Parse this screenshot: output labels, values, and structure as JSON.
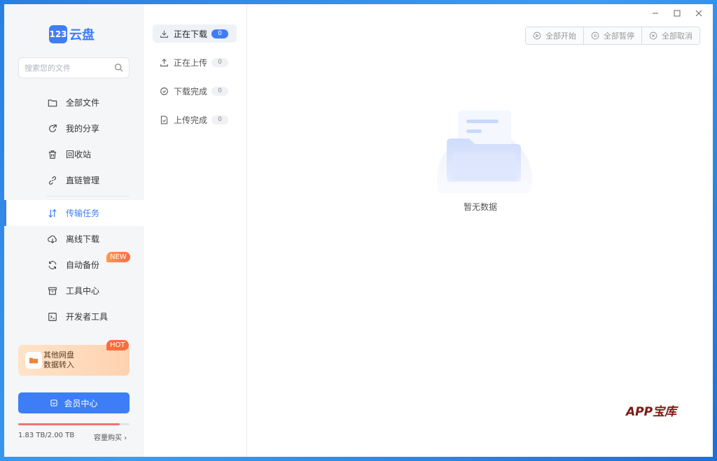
{
  "app": {
    "logo_badge": "123",
    "logo_text": "云盘"
  },
  "search": {
    "placeholder": "搜索您的文件"
  },
  "nav": {
    "items": [
      {
        "label": "全部文件",
        "icon": "folder-icon"
      },
      {
        "label": "我的分享",
        "icon": "share-icon"
      },
      {
        "label": "回收站",
        "icon": "trash-icon"
      },
      {
        "label": "直链管理",
        "icon": "link-icon"
      }
    ],
    "items2": [
      {
        "label": "传输任务",
        "icon": "transfer-icon",
        "active": true
      },
      {
        "label": "离线下载",
        "icon": "cloud-download-icon"
      },
      {
        "label": "自动备份",
        "icon": "sync-icon",
        "badge": "NEW"
      },
      {
        "label": "工具中心",
        "icon": "toolbox-icon"
      },
      {
        "label": "开发者工具",
        "icon": "terminal-icon"
      }
    ]
  },
  "promo": {
    "line1": "其他网盘",
    "line2": "数据转入",
    "badge": "HOT"
  },
  "vip": {
    "label": "会员中心"
  },
  "storage": {
    "text": "1.83 TB/2.00 TB",
    "used_fraction": 0.915,
    "buy_label": "容量购买"
  },
  "transfer_tabs": [
    {
      "label": "正在下载",
      "count": "0",
      "active": true,
      "icon": "download-icon"
    },
    {
      "label": "正在上传",
      "count": "0",
      "icon": "upload-icon"
    },
    {
      "label": "下载完成",
      "count": "0",
      "icon": "check-circle-icon"
    },
    {
      "label": "上传完成",
      "count": "0",
      "icon": "file-check-icon"
    }
  ],
  "actions": {
    "start_all": "全部开始",
    "pause_all": "全部暂停",
    "cancel_all": "全部取消"
  },
  "empty": {
    "text": "暂无数据"
  },
  "watermark": "APP宝库",
  "colors": {
    "accent": "#3d7ef6",
    "storage": "#f07474",
    "hot": "#ff6b3d"
  }
}
